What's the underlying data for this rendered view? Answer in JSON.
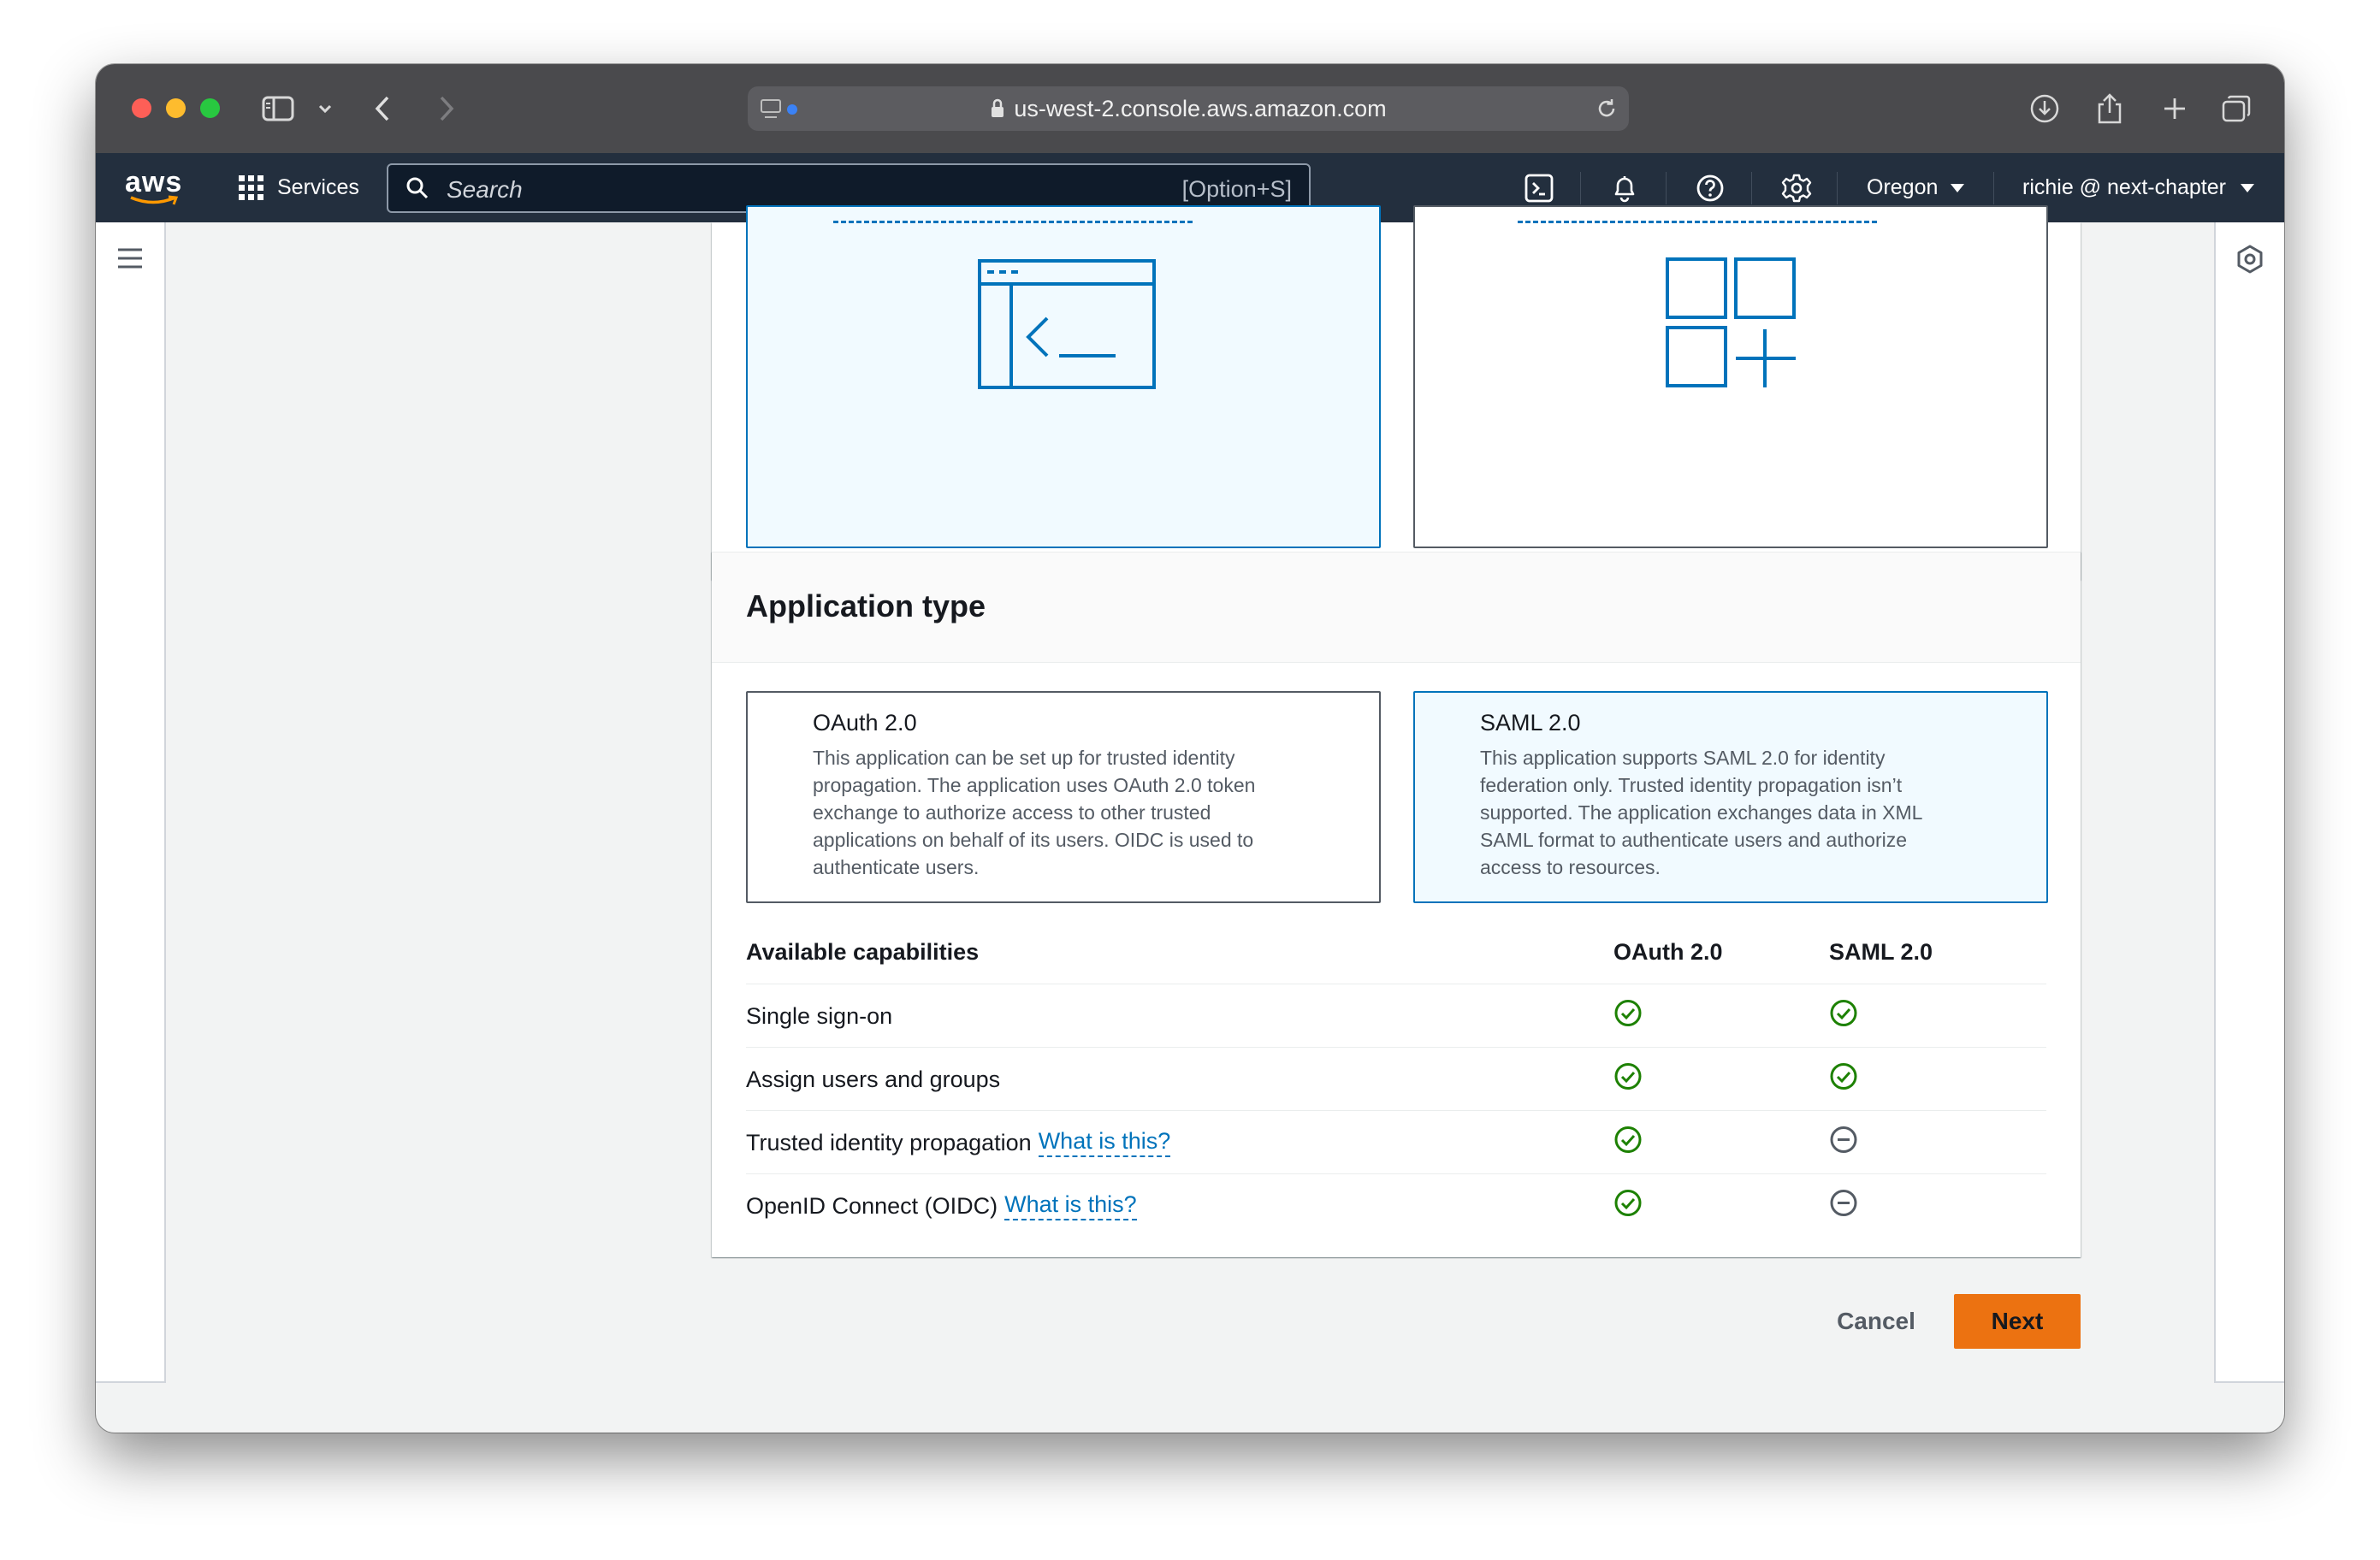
{
  "browser": {
    "url": "us-west-2.console.aws.amazon.com"
  },
  "aws_header": {
    "logo_text": "aws",
    "services_label": "Services",
    "search_placeholder": "Search",
    "search_shortcut": "[Option+S]",
    "region_label": "Oregon",
    "account_label": "richie @ next-chapter"
  },
  "application_type": {
    "heading": "Application type",
    "options": [
      {
        "title": "OAuth 2.0",
        "description": "This application can be set up for trusted identity propagation. The application uses OAuth 2.0 token exchange to authorize access to other trusted applications on behalf of its users. OIDC is used to authenticate users.",
        "selected": false
      },
      {
        "title": "SAML 2.0",
        "description": "This application supports SAML 2.0 for identity federation only. Trusted identity propagation isn’t supported. The application exchanges data in XML SAML format to authenticate users and authorize access to resources.",
        "selected": true
      }
    ]
  },
  "capabilities": {
    "header": "Available capabilities",
    "col_oauth": "OAuth 2.0",
    "col_saml": "SAML 2.0",
    "rows": [
      {
        "label": "Single sign-on",
        "link": "",
        "oauth": "check",
        "saml": "check"
      },
      {
        "label": "Assign users and groups",
        "link": "",
        "oauth": "check",
        "saml": "check"
      },
      {
        "label": "Trusted identity propagation",
        "link": "What is this?",
        "oauth": "check",
        "saml": "not-supported"
      },
      {
        "label": "OpenID Connect (OIDC)",
        "link": "What is this?",
        "oauth": "check",
        "saml": "not-supported"
      }
    ]
  },
  "footer": {
    "cancel_label": "Cancel",
    "next_label": "Next"
  },
  "colors": {
    "accent_blue": "#0073bb",
    "success_green": "#1d8102",
    "primary_orange": "#ec7211",
    "nav_dark": "#232f3e"
  }
}
